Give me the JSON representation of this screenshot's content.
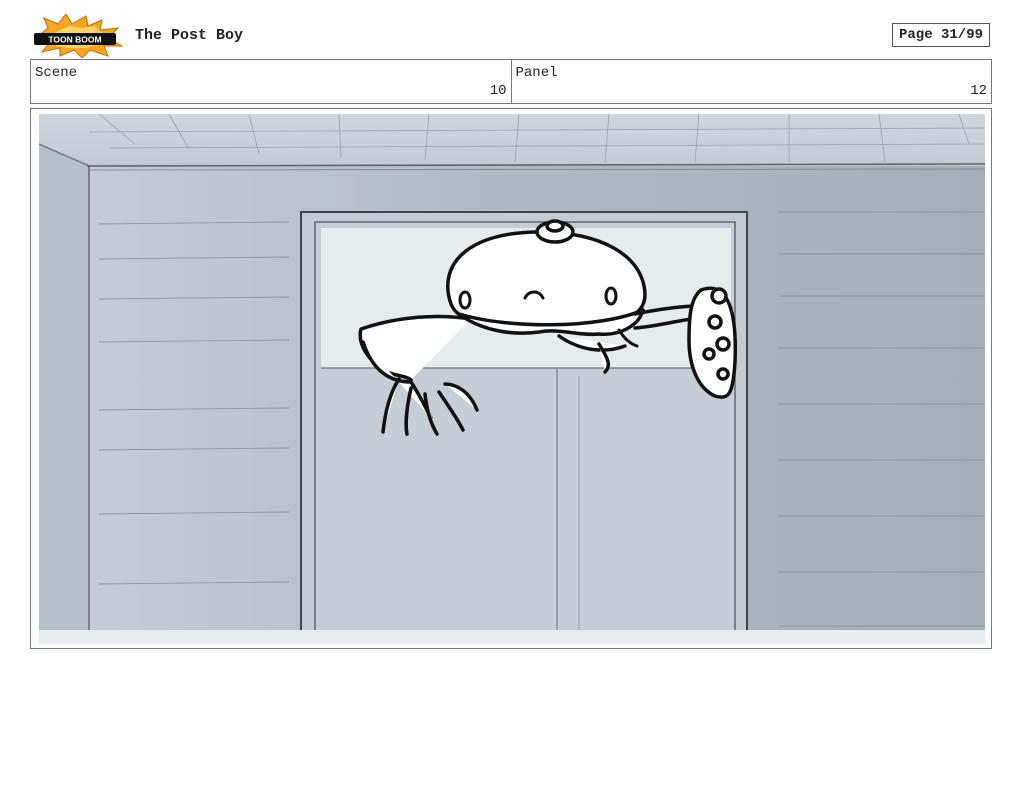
{
  "header": {
    "logo_text": "TOON BOOM",
    "title": "The Post Boy",
    "page": "Page 31/99"
  },
  "info": {
    "scene_label": "Scene",
    "scene_value": "10",
    "panel_label": "Panel",
    "panel_value": "12"
  },
  "colors": {
    "logo_orange": "#f5a623",
    "wall_gray": "#a9b4bd",
    "door_gray": "#c3cbd1",
    "line_dark": "#2b2b2b"
  },
  "icons": {
    "logo": "toon-boom-logo"
  }
}
